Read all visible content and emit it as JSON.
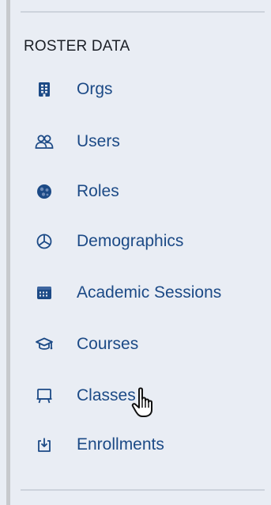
{
  "sidebar": {
    "section_title": "ROSTER DATA",
    "items": [
      {
        "label": "Orgs",
        "icon": "building-icon"
      },
      {
        "label": "Users",
        "icon": "users-icon"
      },
      {
        "label": "Roles",
        "icon": "roles-icon"
      },
      {
        "label": "Demographics",
        "icon": "pie-chart-icon"
      },
      {
        "label": "Academic Sessions",
        "icon": "calendar-icon"
      },
      {
        "label": "Courses",
        "icon": "graduation-cap-icon"
      },
      {
        "label": "Classes",
        "icon": "whiteboard-icon"
      },
      {
        "label": "Enrollments",
        "icon": "enroll-icon"
      }
    ]
  },
  "colors": {
    "panel_bg": "#e9edf4",
    "link": "#1c4a86",
    "heading": "#1b1f26"
  },
  "cursor": {
    "type": "hand-pointer-icon",
    "hovered_item": "Classes"
  }
}
